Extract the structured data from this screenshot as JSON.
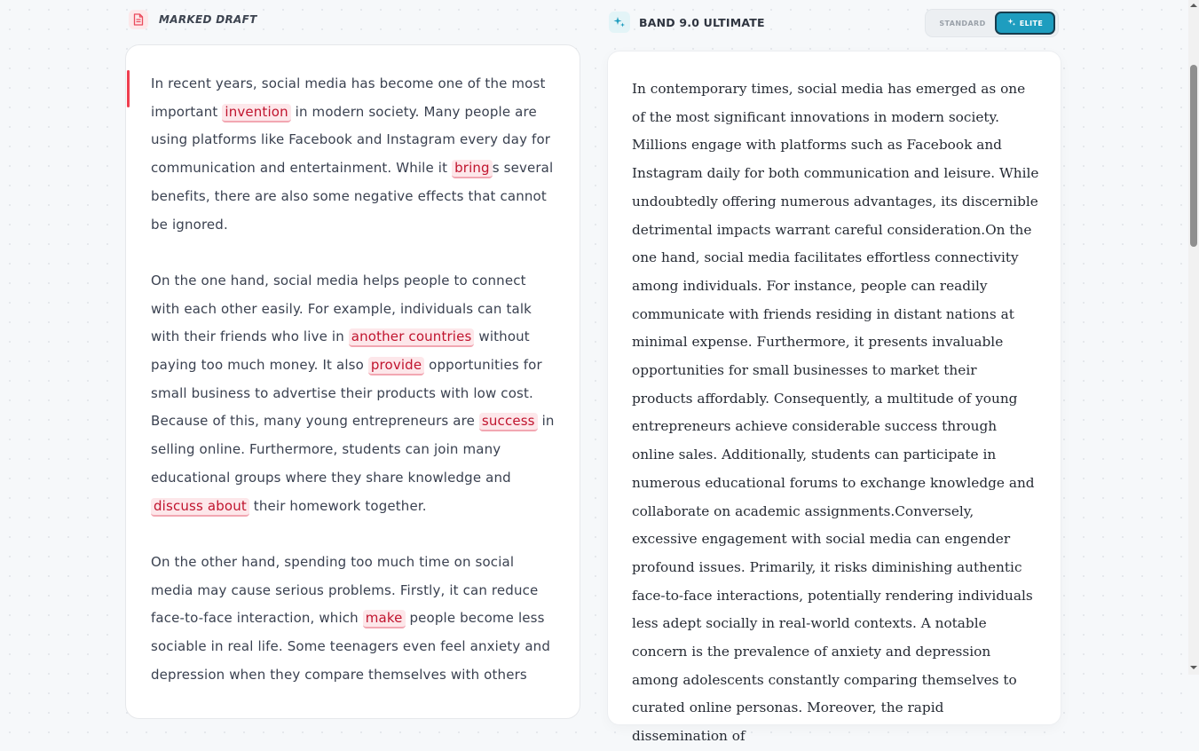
{
  "left_panel": {
    "title": "MARKED DRAFT",
    "icon": "document-icon",
    "paragraphs": [
      [
        {
          "t": "In recent years, social media has become one of the most important "
        },
        {
          "t": "invention",
          "err": true
        },
        {
          "t": " in modern society. Many people are using platforms like Facebook and Instagram every day for communication and entertainment. While it "
        },
        {
          "t": "bring",
          "err": true
        },
        {
          "t": "s several benefits, there are also some negative effects that cannot be ignored."
        }
      ],
      [
        {
          "t": "On the one hand, social media helps people to connect with each other easily. For example, individuals can talk with their friends who live in "
        },
        {
          "t": "another countries",
          "err": true
        },
        {
          "t": " without paying too much money. It also "
        },
        {
          "t": "provide",
          "err": true
        },
        {
          "t": " opportunities for small business to advertise their products with low cost. Because of this, many young entrepreneurs are "
        },
        {
          "t": "success",
          "err": true
        },
        {
          "t": " in selling online. Furthermore, students can join many educational groups where they share knowledge and "
        },
        {
          "t": "discuss about",
          "err": true
        },
        {
          "t": " their homework together."
        }
      ],
      [
        {
          "t": "On the other hand, spending too much time on social media may cause serious problems. Firstly, it can reduce face-to-face interaction, which "
        },
        {
          "t": "make",
          "err": true
        },
        {
          "t": " people become less sociable in real life. Some teenagers even feel anxiety and depression when they compare themselves with others"
        }
      ]
    ]
  },
  "right_panel": {
    "title": "BAND 9.0 ULTIMATE",
    "icon": "sparkle-icon",
    "toggle": {
      "standard_label": "STANDARD",
      "elite_label": "ELITE",
      "active": "ELITE"
    },
    "text": "In contemporary times, social media has emerged as one of the most significant innovations in modern society. Millions engage with platforms such as Facebook and Instagram daily for both communication and leisure. While undoubtedly offering numerous advantages, its discernible detrimental impacts warrant careful consideration.On the one hand, social media facilitates effortless connectivity among individuals. For instance, people can readily communicate with friends residing in distant nations at minimal expense. Furthermore, it presents invaluable opportunities for small businesses to market their products affordably. Consequently, a multitude of young entrepreneurs achieve considerable success through online sales. Additionally, students can participate in numerous educational forums to exchange knowledge and collaborate on academic assignments.Conversely, excessive engagement with social media can engender profound issues. Primarily, it risks diminishing authentic face-to-face interactions, potentially rendering individuals less adept socially in real-world contexts. A notable concern is the prevalence of anxiety and depression among adolescents constantly comparing themselves to curated online personas. Moreover, the rapid dissemination of"
  },
  "colors": {
    "accent": "#ef3e4f",
    "error_bg": "#fde7ea",
    "error_text": "#c0142e",
    "elite": "#1e9dbf"
  }
}
